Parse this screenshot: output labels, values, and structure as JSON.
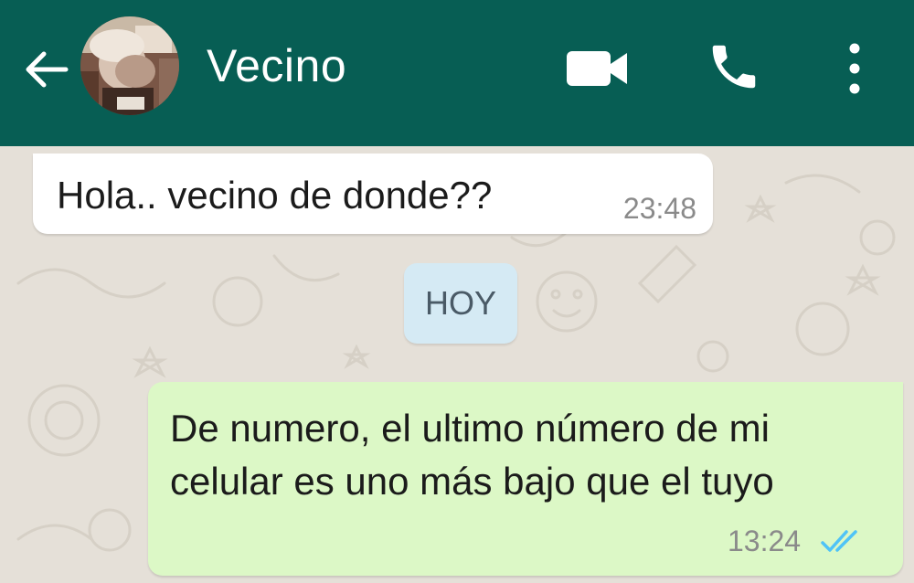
{
  "header": {
    "contact_name": "Vecino",
    "back_icon": "arrow-left-icon",
    "video_icon": "video-camera-icon",
    "call_icon": "phone-icon",
    "menu_icon": "more-vertical-icon",
    "background_color": "#075e54"
  },
  "messages": [
    {
      "direction": "incoming",
      "text": "Hola.. vecino de donde??",
      "time": "23:48"
    },
    {
      "direction": "outgoing",
      "text": "De numero, el ultimo número de mi celular es uno más bajo que el tuyo",
      "time": "13:24",
      "status_icon": "double-check-read-icon"
    }
  ],
  "date_separator": "HOY",
  "colors": {
    "incoming_bubble": "#ffffff",
    "outgoing_bubble": "#dcf8c6",
    "date_chip": "#d5eaf4",
    "read_ticks": "#4fc3f7"
  }
}
